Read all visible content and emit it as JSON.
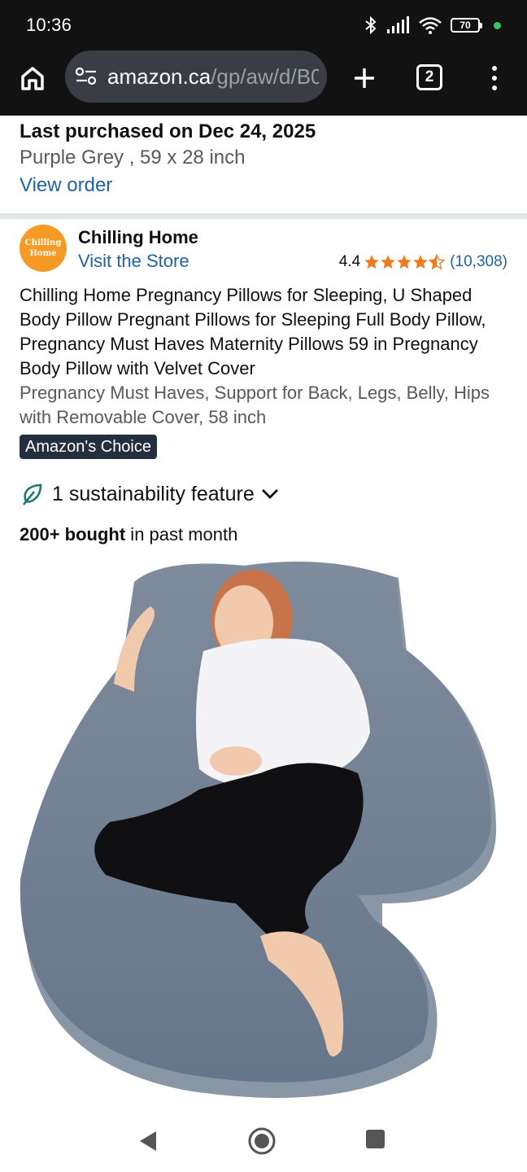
{
  "status_bar": {
    "time": "10:36",
    "battery": "70",
    "icons": [
      "bluetooth-icon",
      "signal-icon",
      "wifi-icon",
      "battery-icon"
    ]
  },
  "browser": {
    "url_domain": "amazon.ca",
    "url_path": "/gp/aw/d/B0",
    "tab_count": "2"
  },
  "purchase": {
    "title": "Last purchased on Dec 24, 2025",
    "variant": "Purple Grey , 59 x 28 inch",
    "link": "View order"
  },
  "brand": {
    "logo_text_line1": "Chilling",
    "logo_text_line2": "Home",
    "name": "Chilling Home",
    "store_link": "Visit the Store",
    "rating_value": "4.4",
    "rating_count": "(10,308)",
    "stars": 4.4
  },
  "product": {
    "title": "Chilling Home Pregnancy Pillows for Sleeping, U Shaped Body Pillow Pregnant Pillows for Sleeping Full Body Pillow, Pregnancy Must Haves Maternity Pillows 59 in Pregnancy Body Pillow with Velvet Cover",
    "subtitle": "Pregnancy Must Haves, Support for Back, Legs, Belly, Hips with Removable Cover, 58 inch",
    "badge": "Amazon's Choice",
    "sustainability": "1 sustainability feature",
    "bought_bold": "200+ bought",
    "bought_rest": " in past month"
  },
  "colors": {
    "link": "#2162a1",
    "star": "#f17a1e",
    "badge_bg": "#232f3e",
    "pillow": "#7a8798",
    "logo": "#f59a24"
  }
}
